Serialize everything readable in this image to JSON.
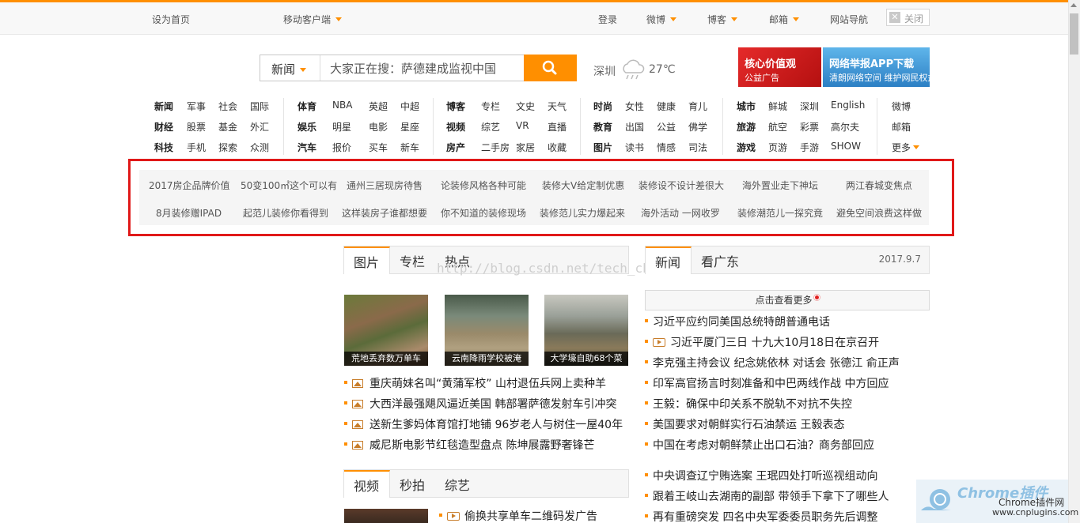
{
  "topbar": {
    "set_home": "设为首页",
    "mobile_client": "移动客户端",
    "login": "登录",
    "weibo": "微博",
    "blog": "博客",
    "mail": "邮箱",
    "site_nav": "网站导航",
    "close": "关闭"
  },
  "search": {
    "category": "新闻",
    "value": "大家正在搜：萨德建成监视中国"
  },
  "weather": {
    "city": "深圳",
    "temp": "27℃"
  },
  "ads": [
    {
      "line1": "核心价值观",
      "line2": "公益广告"
    },
    {
      "line1": "网络举报APP下载",
      "line2": "清朗网络空间 维护网民权益"
    }
  ],
  "nav": {
    "col1": [
      [
        "新闻",
        "军事",
        "社会",
        "国际"
      ],
      [
        "财经",
        "股票",
        "基金",
        "外汇"
      ],
      [
        "科技",
        "手机",
        "探索",
        "众测"
      ]
    ],
    "col2": [
      [
        "体育",
        "NBA",
        "英超",
        "中超"
      ],
      [
        "娱乐",
        "明星",
        "电影",
        "星座"
      ],
      [
        "汽车",
        "报价",
        "买车",
        "新车"
      ]
    ],
    "col3": [
      [
        "博客",
        "专栏",
        "文史",
        "天气"
      ],
      [
        "视频",
        "综艺",
        "VR",
        "直播"
      ],
      [
        "房产",
        "二手房",
        "家居",
        "收藏"
      ]
    ],
    "col4": [
      [
        "时尚",
        "女性",
        "健康",
        "育儿"
      ],
      [
        "教育",
        "出国",
        "公益",
        "佛学"
      ],
      [
        "图片",
        "读书",
        "情感",
        "司法"
      ]
    ],
    "col5": [
      [
        "城市",
        "鲜城",
        "深圳",
        "English"
      ],
      [
        "旅游",
        "航空",
        "彩票",
        "高尔夫"
      ],
      [
        "游戏",
        "页游",
        "手游",
        "SHOW"
      ]
    ],
    "col6": [
      "微博",
      "邮箱",
      "更多"
    ]
  },
  "tags": {
    "row1": [
      "2017房企品牌价值",
      "50变100㎡这个可以有",
      "通州三居现房待售",
      "论装修风格各种可能",
      "装修大V给定制优惠",
      "装修设不设计差很大",
      "海外置业走下神坛",
      "两江春城变焦点"
    ],
    "row2": [
      "8月装修赠IPAD",
      "起范儿装修你看得到",
      "这样装房子谁都想要",
      "你不知道的装修现场",
      "装修范儿实力爆起来",
      "海外活动 一网收罗",
      "装修潮范儿一探究竟",
      "避免空间浪费这样做"
    ]
  },
  "photo_section": {
    "tabs": [
      "图片",
      "专栏",
      "热点"
    ],
    "watermark": "http://blog.csdn.net/tech_ch",
    "photos": [
      "荒地丢弃数万单车",
      "云南降雨学校被淹",
      "大学壕自助68个菜"
    ],
    "items": [
      "重庆萌妹名叫“黄蒲军校” 山村退伍兵网上卖种羊",
      "大西洋最强飓风逼近美国 韩部署萨德发射车引冲突",
      "送新生爹妈体育馆打地铺 96岁老人与树住一屋40年",
      "威尼斯电影节红毯造型盘点 陈坤展露野奢锋芒"
    ]
  },
  "news_section": {
    "tabs": [
      "新闻",
      "看广东"
    ],
    "date": "2017.9.7",
    "more": "点击查看更多",
    "items": [
      "习近平应约同美国总统特朗普通电话",
      "习近平厦门三日 十九大10月18日在京召开",
      "李克强主持会议 纪念姚依林 对话会 张德江 俞正声",
      "印军高官扬言时刻准备和中巴两线作战 中方回应",
      "王毅：确保中印关系不脱轨不对抗不失控",
      "美国要求对朝鲜实行石油禁运 王毅表态",
      "中国在考虑对朝鲜禁止出口石油？商务部回应"
    ],
    "items2": [
      "中央调查辽宁贿选案 王珉四处打听巡视组动向",
      "跟着王岐山去湖南的副部 带领手下拿下了哪些人",
      "再有重磅突发 四名中央军委委员职务先后调整"
    ]
  },
  "video_section": {
    "tabs": [
      "视频",
      "秒拍",
      "综艺"
    ],
    "items": [
      "偷换共享单车二维码发广告"
    ]
  },
  "chrome_logo": {
    "title": "Chrome插件",
    "sub": "Chrome插件网",
    "url": "www.cnplugins.com"
  },
  "colors": {
    "accent": "#ff8f00",
    "frame": "#e01919"
  }
}
